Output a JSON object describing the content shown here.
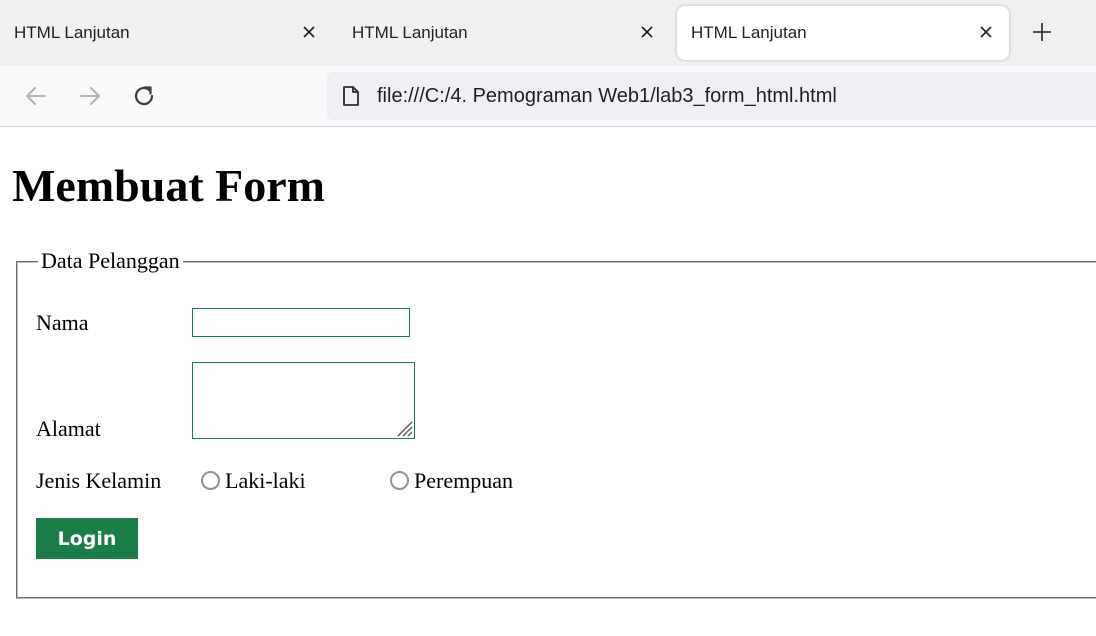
{
  "browser": {
    "tabs": [
      {
        "title": "HTML Lanjutan",
        "active": false
      },
      {
        "title": "HTML Lanjutan",
        "active": false
      },
      {
        "title": "HTML Lanjutan",
        "active": true
      }
    ],
    "address_bar": {
      "url": "file:///C:/4. Pemograman Web1/lab3_form_html.html",
      "icon": "page-icon"
    },
    "nav_icons": [
      "back-arrow-icon",
      "forward-arrow-icon",
      "reload-icon"
    ]
  },
  "page": {
    "heading": "Membuat Form",
    "fieldset": {
      "legend": "Data Pelanggan",
      "fields": {
        "nama": {
          "label": "Nama",
          "value": ""
        },
        "alamat": {
          "label": "Alamat",
          "value": ""
        },
        "jenis_kelamin": {
          "label": "Jenis Kelamin",
          "options": [
            "Laki-laki",
            "Perempuan"
          ],
          "selected": null
        }
      },
      "submit_label": "Login"
    }
  },
  "colors": {
    "accent": "#1b7e48",
    "tab_strip_bg": "#f0f0f0",
    "toolbar_bg": "#f9f9fb",
    "url_bar_bg": "#f0f0f4",
    "radio_border": "#8f8f9d"
  }
}
